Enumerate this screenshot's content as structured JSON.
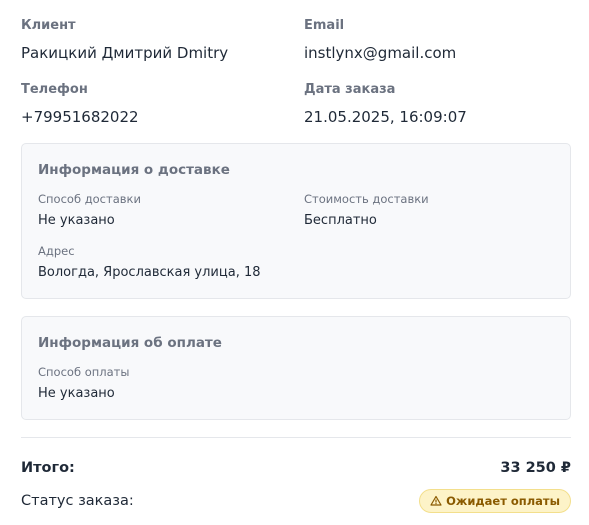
{
  "customer": {
    "client_label": "Клиент",
    "client_value": "Ракицкий Дмитрий Dmitry",
    "email_label": "Email",
    "email_value": "instlynx@gmail.com",
    "phone_label": "Телефон",
    "phone_value": "+79951682022",
    "date_label": "Дата заказа",
    "date_value": "21.05.2025, 16:09:07"
  },
  "delivery": {
    "title": "Информация о доставке",
    "method_label": "Способ доставки",
    "method_value": "Не указано",
    "cost_label": "Стоимость доставки",
    "cost_value": "Бесплатно",
    "address_label": "Адрес",
    "address_value": "Вологда, Ярославская улица, 18"
  },
  "payment": {
    "title": "Информация об оплате",
    "method_label": "Способ оплаты",
    "method_value": "Не указано"
  },
  "summary": {
    "total_label": "Итого:",
    "total_value": "33 250 ₽",
    "status_label": "Статус заказа:",
    "status_badge": "Ожидает оплаты",
    "status_icon": "warning-triangle-icon",
    "badge_bg": "#fdf3c8",
    "badge_color": "#8a5a00"
  }
}
